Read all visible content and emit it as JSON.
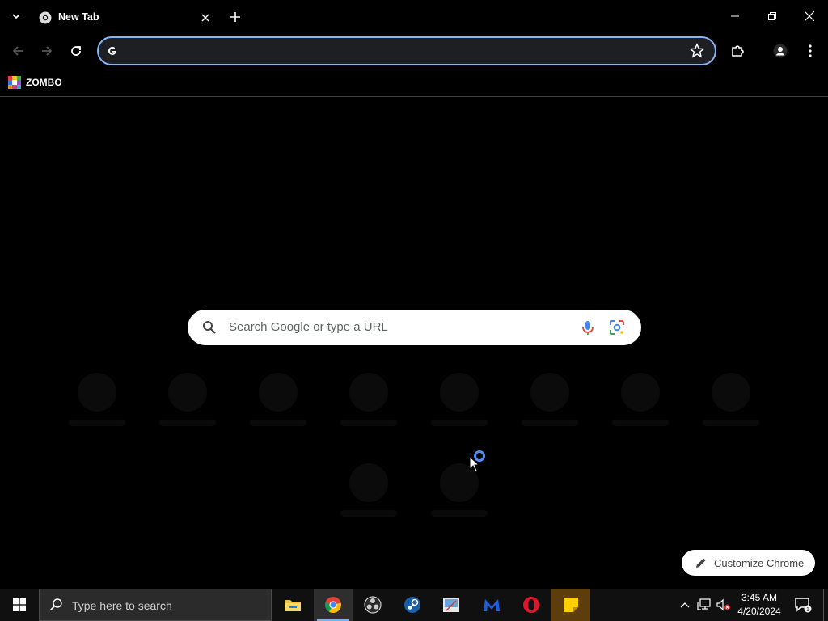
{
  "browser": {
    "tab": {
      "title": "New Tab",
      "favicon": "chrome-icon"
    },
    "omnibox": {
      "value": "",
      "placeholder": ""
    },
    "bookmarks": [
      {
        "label": "ZOMBO",
        "icon": "zombo-favicon"
      }
    ]
  },
  "new_tab_page": {
    "search_placeholder": "Search Google or type a URL",
    "customize_label": "Customize Chrome",
    "shortcuts_count": 10
  },
  "taskbar": {
    "search_placeholder": "Type here to search",
    "apps": [
      "file-explorer-icon",
      "chrome-icon",
      "obs-icon",
      "steam-icon",
      "snipping-icon",
      "malwarebytes-icon",
      "opera-icon",
      "sticky-notes-icon"
    ],
    "clock": {
      "time": "3:45 AM",
      "date": "4/20/2024"
    },
    "notification_count": "1"
  },
  "colors": {
    "accent": "#8ab4f8",
    "background": "#000000",
    "spinner": "#4c8df6"
  }
}
